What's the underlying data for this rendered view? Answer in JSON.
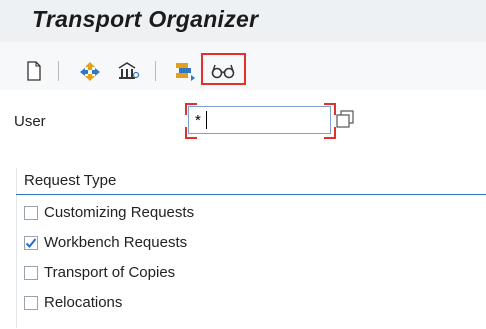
{
  "window": {
    "title": "Transport Organizer"
  },
  "toolbar": {
    "buttons": [
      {
        "id": "create",
        "icon": "new-document-icon"
      },
      {
        "id": "transport",
        "icon": "transport-icon"
      },
      {
        "id": "display-object",
        "icon": "display-object-icon"
      },
      {
        "id": "release",
        "icon": "release-icon"
      },
      {
        "id": "display",
        "icon": "glasses-icon",
        "highlighted": true
      }
    ]
  },
  "form": {
    "user_label": "User",
    "user_value": "*"
  },
  "request_type": {
    "title": "Request Type",
    "options": [
      {
        "label": "Customizing Requests",
        "checked": false
      },
      {
        "label": "Workbench Requests",
        "checked": true
      },
      {
        "label": "Transport of Copies",
        "checked": false
      },
      {
        "label": "Relocations",
        "checked": false
      }
    ]
  },
  "colors": {
    "accent": "#2f78c4",
    "highlight": "#e0322b",
    "check": "#1f6fd1"
  }
}
